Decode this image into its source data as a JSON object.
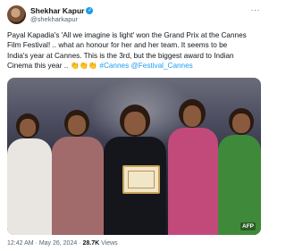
{
  "user": {
    "display_name": "Shekhar Kapur",
    "handle": "@shekharkapur",
    "verified_icon": "verified-badge-icon"
  },
  "more_label": "···",
  "tweet": {
    "line1": "Payal Kapadia's 'All we imagine is light' won the Grand Prix at the Cannes",
    "line2": "Film Festival! .. what an honour for her and her team. It seems to be",
    "line3": "India's year at Cannes. This is the 3rd, but the biggest award to Indian",
    "line4_prefix": "Cinema this year .. ",
    "claps": "👏👏👏",
    "hashtag": "#Cannes",
    "mention": "@Festival_Cannes"
  },
  "media": {
    "credit": "AFP"
  },
  "meta": {
    "time": "12:42 AM",
    "date": "May 26, 2024",
    "views_count": "28.7K",
    "views_label": "Views"
  },
  "colors": {
    "accent": "#1d9bf0",
    "text": "#0f1419",
    "secondary": "#536471"
  }
}
